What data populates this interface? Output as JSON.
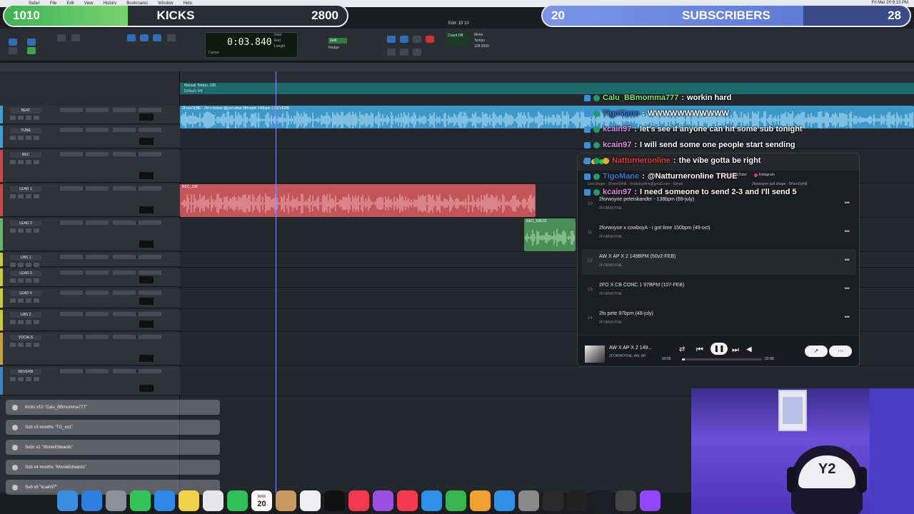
{
  "menubar": {
    "items": [
      "Safari",
      "File",
      "Edit",
      "View",
      "History",
      "Bookmarks",
      "Window",
      "Help"
    ],
    "clock": "Fri Mar 20  9:13 PM"
  },
  "goals": {
    "kicks": {
      "current": "1010",
      "label": "KICKS",
      "target": "2800",
      "progress": 0.36
    },
    "subscribers": {
      "current": "20",
      "label": "SUBSCRIBERS",
      "target": "28",
      "progress": 0.71
    }
  },
  "transport": {
    "edit_window_title": "Edit: 10 10",
    "main_counter": "0:03.840",
    "start_label": "Start",
    "end_label": "End",
    "length_label": "Length",
    "cursor_label": "Cursor",
    "grid_label": "Grid",
    "nudge_label": "Nudge",
    "count_off_label": "Count Off",
    "meter_label": "Meter",
    "tempo_label": "Tempo",
    "tempo_value": "128.0000"
  },
  "tempo_ruler": {
    "label": "Manual Tempo: 128",
    "sub": "Default: 4/4"
  },
  "tracks": [
    {
      "name": "BEAT",
      "color": "#3fa0d6"
    },
    {
      "name": "TUNE",
      "color": "#3fa0d6"
    },
    {
      "name": "REC",
      "color": "#d04545"
    },
    {
      "name": "LEAD 1",
      "color": "#d04545"
    },
    {
      "name": "LEAD 2",
      "color": "#62b865"
    },
    {
      "name": "LIBS 1",
      "color": "#c8c83a"
    },
    {
      "name": "LEAD 3",
      "color": "#c8c83a"
    },
    {
      "name": "LEAD 4",
      "color": "#c8c83a"
    },
    {
      "name": "LIBS 2",
      "color": "#c8c83a"
    },
    {
      "name": "VOCALS",
      "color": "#c8a03a"
    },
    {
      "name": "REVERB",
      "color": "#3a86c8"
    }
  ],
  "clips": {
    "beat": "2ForeOyNE - 2fo x bonus @yurcubbe 5ftmaphi 140bpm 2 REVERB",
    "rec": "REC_106",
    "lead2": "REC_106.02",
    "colors": {
      "beat": "#3e98c7",
      "rec": "#c2545b",
      "lead2": "#4c8e5a"
    }
  },
  "chat": [
    {
      "user": "Calu_BBmomma777",
      "message": "workin hard",
      "color": "#7cea6c",
      "badges": [
        "mod",
        "star"
      ]
    },
    {
      "user": "TigoMane",
      "message": "WWWWWWWWWWW",
      "color": "#3a7bd6",
      "badges": [
        "mod",
        "star"
      ]
    },
    {
      "user": "kcain97",
      "message": "let's see if anyone can hit some sub tonight",
      "color": "#e88ce6",
      "badges": [
        "mod",
        "star"
      ]
    },
    {
      "user": "kcain97",
      "message": "I will send some one people start sending",
      "color": "#e88ce6",
      "badges": [
        "mod",
        "star"
      ]
    },
    {
      "user": "Natturneronline",
      "message": "the vibe gotta be right",
      "color": "#e83b3b",
      "badges": [
        "mod",
        "star",
        "warn"
      ]
    },
    {
      "user": "TigoMane",
      "message": "@Natturneronline TRUE",
      "color": "#3a7bd6",
      "badges": [
        "mod",
        "star"
      ]
    },
    {
      "user": "kcain97",
      "message": "I need someone to send 2-3 and I'll send 5",
      "color": "#e88ce6",
      "badges": [
        "mod",
        "star"
      ]
    }
  ],
  "player": {
    "tabs": [
      {
        "label": "YouTube",
        "icon": "youtube-icon"
      },
      {
        "label": "Instagram",
        "icon": "instagram-icon"
      },
      {
        "label": "2forwoyne just shape - 2ForeOyNE",
        "icon": "tab-icon"
      }
    ],
    "url_hint": "Just shape - 2ForeOyNE - beatsbyplinn@gmail.com - Gmail",
    "rows": [
      {
        "num": "10",
        "title": "2forwoyne peteiskander - 138bpm (69-july)",
        "artist": "2FORWOYNE"
      },
      {
        "num": "11",
        "title": "2forwoyne x cowboyA - i got time 150bpm (49-oct)",
        "artist": "2FORWOYNE"
      },
      {
        "num": "12",
        "title": "AW X AP X 2 149BPM (50v2-FEB)",
        "artist": "2FORWOYNE"
      },
      {
        "num": "13",
        "title": "2FO X CB CONC 1 97BPM (107-FEB)",
        "artist": "2FORWOYNE"
      },
      {
        "num": "14",
        "title": "2fo pete 97bpm (48-july)",
        "artist": "2FORWOYNE"
      }
    ],
    "now_playing": {
      "title": "AW X AP X 2 149...",
      "artist": "2FORWOYNE, AW, AP",
      "elapsed": "00:05",
      "total": "02:08",
      "progress": 0.04
    }
  },
  "alerts": [
    {
      "text": "Kicks x10 \"Calu_BBmomma777\"",
      "icon": "kick-icon"
    },
    {
      "text": "Sub x3 months \"TG_xo1\"",
      "icon": "star-icon"
    },
    {
      "text": "Subs x1 \"MonieEdwards\"",
      "icon": "gift-icon"
    },
    {
      "text": "Sub x4 months \"MonieEdwards\"",
      "icon": "star-icon"
    },
    {
      "text": "Sub x5 \"kcain97\"",
      "icon": "gift-icon"
    }
  ],
  "dock": {
    "calendar_month": "MAR",
    "calendar_day": "20",
    "apps": [
      "finder",
      "safari",
      "launchpad",
      "messages",
      "mail",
      "notes",
      "photos",
      "facetime",
      "calendar",
      "contacts",
      "reminders",
      "appletv",
      "music",
      "podcasts",
      "news",
      "keynote",
      "numbers",
      "pages",
      "appstore",
      "settings",
      "logic",
      "ilok",
      "obs",
      "streamdeck",
      "twitch"
    ]
  },
  "webcam": {
    "cap_logo": "Y2"
  }
}
